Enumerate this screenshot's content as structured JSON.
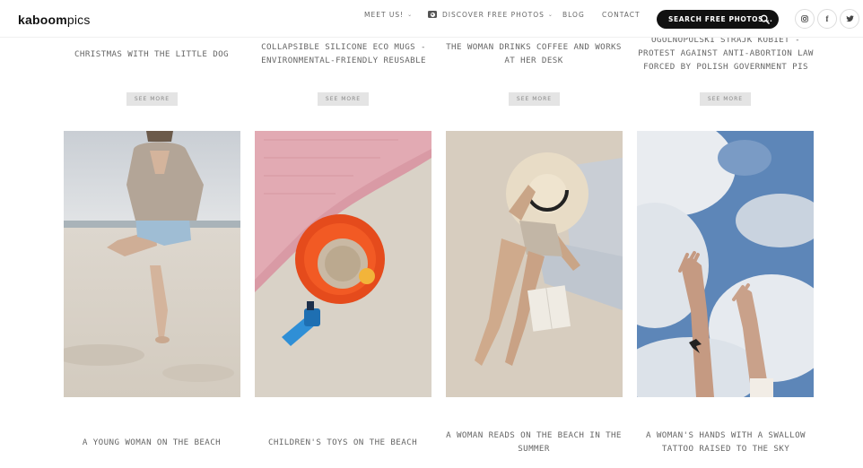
{
  "header": {
    "logo_bold": "kaboom",
    "logo_light": "pics",
    "nav": [
      {
        "label": "MEET US!",
        "has_chevron": true
      },
      {
        "label": "DISCOVER FREE PHOTOS",
        "has_chevron": true,
        "icon": "camera-icon"
      },
      {
        "label": "BLOG",
        "has_chevron": false
      },
      {
        "label": "CONTACT",
        "has_chevron": false
      }
    ],
    "search_label": "SEARCH FREE PHOTOS...",
    "social": [
      "instagram-icon",
      "facebook-icon",
      "twitter-icon"
    ]
  },
  "top_row": [
    {
      "title": "CHRISTMAS WITH THE LITTLE DOG",
      "button": "SEE MORE"
    },
    {
      "title": "COLLAPSIBLE SILICONE ECO MUGS - ENVIRONMENTAL-FRIENDLY REUSABLE",
      "button": "SEE MORE"
    },
    {
      "title": "THE WOMAN DRINKS COFFEE AND WORKS AT HER DESK",
      "button": "SEE MORE"
    },
    {
      "title": "OGOLNOPOLSKI STRAJK KOBIET - PROTEST AGAINST ANTI-ABORTION LAW FORCED BY POLISH GOVERNMENT PIS",
      "button": "SEE MORE"
    }
  ],
  "bottom_row": [
    {
      "title": "A YOUNG WOMAN ON THE BEACH"
    },
    {
      "title": "CHILDREN'S TOYS ON THE BEACH"
    },
    {
      "title": "A WOMAN READS ON THE BEACH IN THE SUMMER"
    },
    {
      "title": "A WOMAN'S HANDS WITH A SWALLOW TATTOO RAISED TO THE SKY"
    }
  ]
}
